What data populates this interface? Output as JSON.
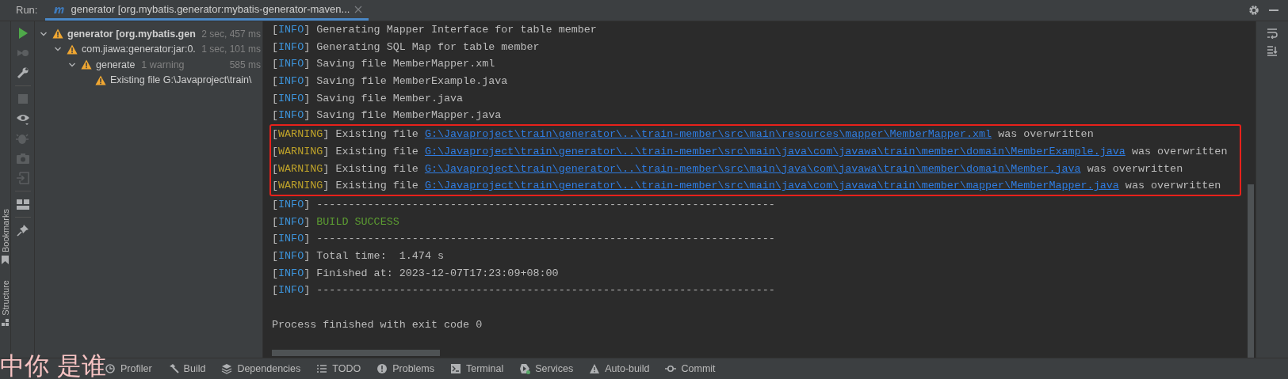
{
  "run_bar": {
    "label": "Run:",
    "tabs": [
      {
        "title": "generator [org.mybatis.generator:mybatis-generator-maven...",
        "selected": true
      }
    ]
  },
  "left_toolbar": [
    {
      "kind": "run",
      "disabled": false
    },
    {
      "kind": "rerun",
      "disabled": true
    },
    {
      "kind": "wrench",
      "disabled": false
    },
    {
      "kind": "sep"
    },
    {
      "kind": "stop",
      "disabled": true
    },
    {
      "kind": "eye",
      "disabled": false
    },
    {
      "kind": "bug",
      "disabled": true
    },
    {
      "kind": "camera",
      "disabled": true
    },
    {
      "kind": "exit",
      "disabled": true
    },
    {
      "kind": "sep"
    },
    {
      "kind": "layout",
      "disabled": false
    },
    {
      "kind": "sep"
    },
    {
      "kind": "pin",
      "disabled": false
    }
  ],
  "side_labels": [
    "Bookmarks",
    "Structure"
  ],
  "tree": [
    {
      "label": "generator [org.mybatis.gen",
      "time": "2 sec, 457 ms",
      "expanded": true,
      "children": [
        {
          "label": "com.jiawa:generator:jar:0.",
          "time": "1 sec, 101 ms",
          "expanded": true,
          "children": [
            {
              "label": "generate",
              "note": "1 warning",
              "time": "585 ms",
              "expanded": true,
              "children": [
                {
                  "label": "Existing file G:\\Javaproject\\train\\"
                }
              ]
            }
          ]
        }
      ]
    }
  ],
  "console": [
    {
      "kind": "info",
      "tag_open": "[",
      "tag": "INFO",
      "tag_close": "]",
      "text": "Generating Mapper Interface for table member",
      "highlighted": false
    },
    {
      "kind": "info",
      "tag_open": "[",
      "tag": "INFO",
      "tag_close": "]",
      "text": "Generating SQL Map for table member",
      "highlighted": false
    },
    {
      "kind": "info",
      "tag_open": "[",
      "tag": "INFO",
      "tag_close": "]",
      "text": "Saving file MemberMapper.xml",
      "highlighted": false
    },
    {
      "kind": "info",
      "tag_open": "[",
      "tag": "INFO",
      "tag_close": "]",
      "text": "Saving file MemberExample.java",
      "highlighted": false
    },
    {
      "kind": "info",
      "tag_open": "[",
      "tag": "INFO",
      "tag_close": "]",
      "text": "Saving file Member.java",
      "highlighted": false
    },
    {
      "kind": "info",
      "tag_open": "[",
      "tag": "INFO",
      "tag_close": "]",
      "text": "Saving file MemberMapper.java",
      "highlighted": false
    },
    {
      "kind": "warning",
      "tag_open": "[",
      "tag": "WARNING",
      "tag_close": "]",
      "text": "Existing file",
      "link": "G:\\Javaproject\\train\\generator\\..\\train-member\\src\\main\\resources\\mapper\\MemberMapper.xml",
      "after": "was overwritten",
      "highlighted": true
    },
    {
      "kind": "warning",
      "tag_open": "[",
      "tag": "WARNING",
      "tag_close": "]",
      "text": "Existing file",
      "link": "G:\\Javaproject\\train\\generator\\..\\train-member\\src\\main\\java\\com\\javawa\\train\\member\\domain\\MemberExample.java",
      "after": "was overwritten",
      "highlighted": true
    },
    {
      "kind": "warning",
      "tag_open": "[",
      "tag": "WARNING",
      "tag_close": "]",
      "text": "Existing file",
      "link": "G:\\Javaproject\\train\\generator\\..\\train-member\\src\\main\\java\\com\\javawa\\train\\member\\domain\\Member.java",
      "after": "was overwritten",
      "highlighted": true
    },
    {
      "kind": "warning",
      "tag_open": "[",
      "tag": "WARNING",
      "tag_close": "]",
      "text": "Existing file",
      "link": "G:\\Javaproject\\train\\generator\\..\\train-member\\src\\main\\java\\com\\javawa\\train\\member\\mapper\\MemberMapper.java",
      "after": "was overwritten",
      "highlighted": true
    },
    {
      "kind": "info",
      "tag_open": "[",
      "tag": "INFO",
      "tag_close": "]",
      "text": "------------------------------------------------------------------------",
      "highlighted": false
    },
    {
      "kind": "success",
      "tag_open": "[",
      "tag": "INFO",
      "tag_close": "]",
      "text": "BUILD SUCCESS",
      "highlighted": false
    },
    {
      "kind": "info",
      "tag_open": "[",
      "tag": "INFO",
      "tag_close": "]",
      "text": "------------------------------------------------------------------------",
      "highlighted": false
    },
    {
      "kind": "info",
      "tag_open": "[",
      "tag": "INFO",
      "tag_close": "]",
      "text": "Total time:  1.474 s",
      "highlighted": false
    },
    {
      "kind": "info",
      "tag_open": "[",
      "tag": "INFO",
      "tag_close": "]",
      "text": "Finished at: 2023-12-07T17:23:09+08:00",
      "highlighted": false
    },
    {
      "kind": "info",
      "tag_open": "[",
      "tag": "INFO",
      "tag_close": "]",
      "text": "------------------------------------------------------------------------",
      "highlighted": false
    },
    {
      "kind": "blank"
    },
    {
      "kind": "plain",
      "text": "Process finished with exit code 0",
      "highlighted": false
    }
  ],
  "bottom_tabs": [
    {
      "label": "Profiler",
      "kind": "profiler"
    },
    {
      "label": "Build",
      "kind": "build"
    },
    {
      "label": "Dependencies",
      "kind": "dependencies"
    },
    {
      "label": "TODO",
      "kind": "todo"
    },
    {
      "label": "Problems",
      "kind": "problems"
    },
    {
      "label": "Terminal",
      "kind": "terminal"
    },
    {
      "label": "Services",
      "kind": "services"
    },
    {
      "label": "Auto-build",
      "kind": "autobuild"
    },
    {
      "label": "Commit",
      "kind": "commit"
    }
  ],
  "overlay_text": "中你 是谁"
}
